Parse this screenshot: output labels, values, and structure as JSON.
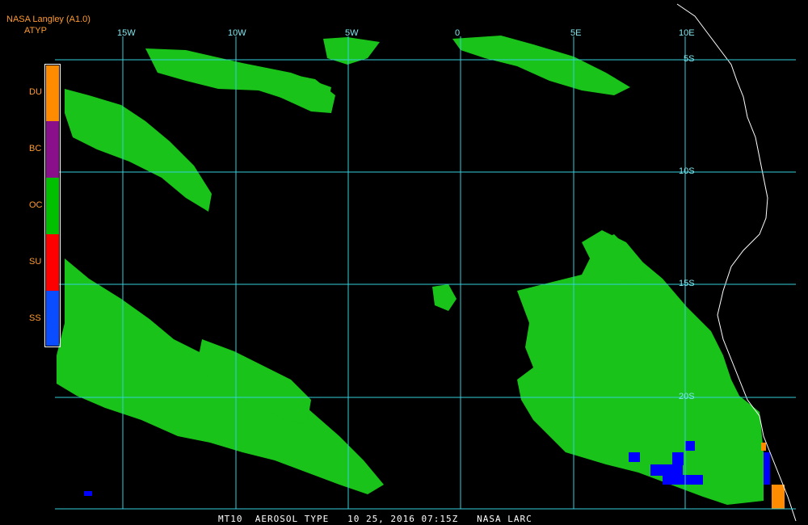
{
  "header": {
    "title": "NASA Langley (A1.0)",
    "product": "ATYP"
  },
  "legend": {
    "items": [
      {
        "code": "DU",
        "color": "#ff8c00"
      },
      {
        "code": "BC",
        "color": "#8a0f8a"
      },
      {
        "code": "OC",
        "color": "#00c000"
      },
      {
        "code": "SU",
        "color": "#ff0000"
      },
      {
        "code": "SS",
        "color": "#0a4cff"
      }
    ]
  },
  "grid": {
    "lon_labels": [
      "15W",
      "10W",
      "5W",
      "0",
      "5E",
      "10E"
    ],
    "lat_labels": [
      "5S",
      "10S",
      "15S",
      "20S"
    ],
    "color": "#35d0dc"
  },
  "colors": {
    "aerosol_green": "#19c319",
    "coast": "#ffffff",
    "sea_salt": "#0000ff",
    "dust": "#ff8c00"
  },
  "footer": {
    "text": "MT10  AEROSOL TYPE   10 25, 2016 07:15Z   NASA LARC"
  }
}
